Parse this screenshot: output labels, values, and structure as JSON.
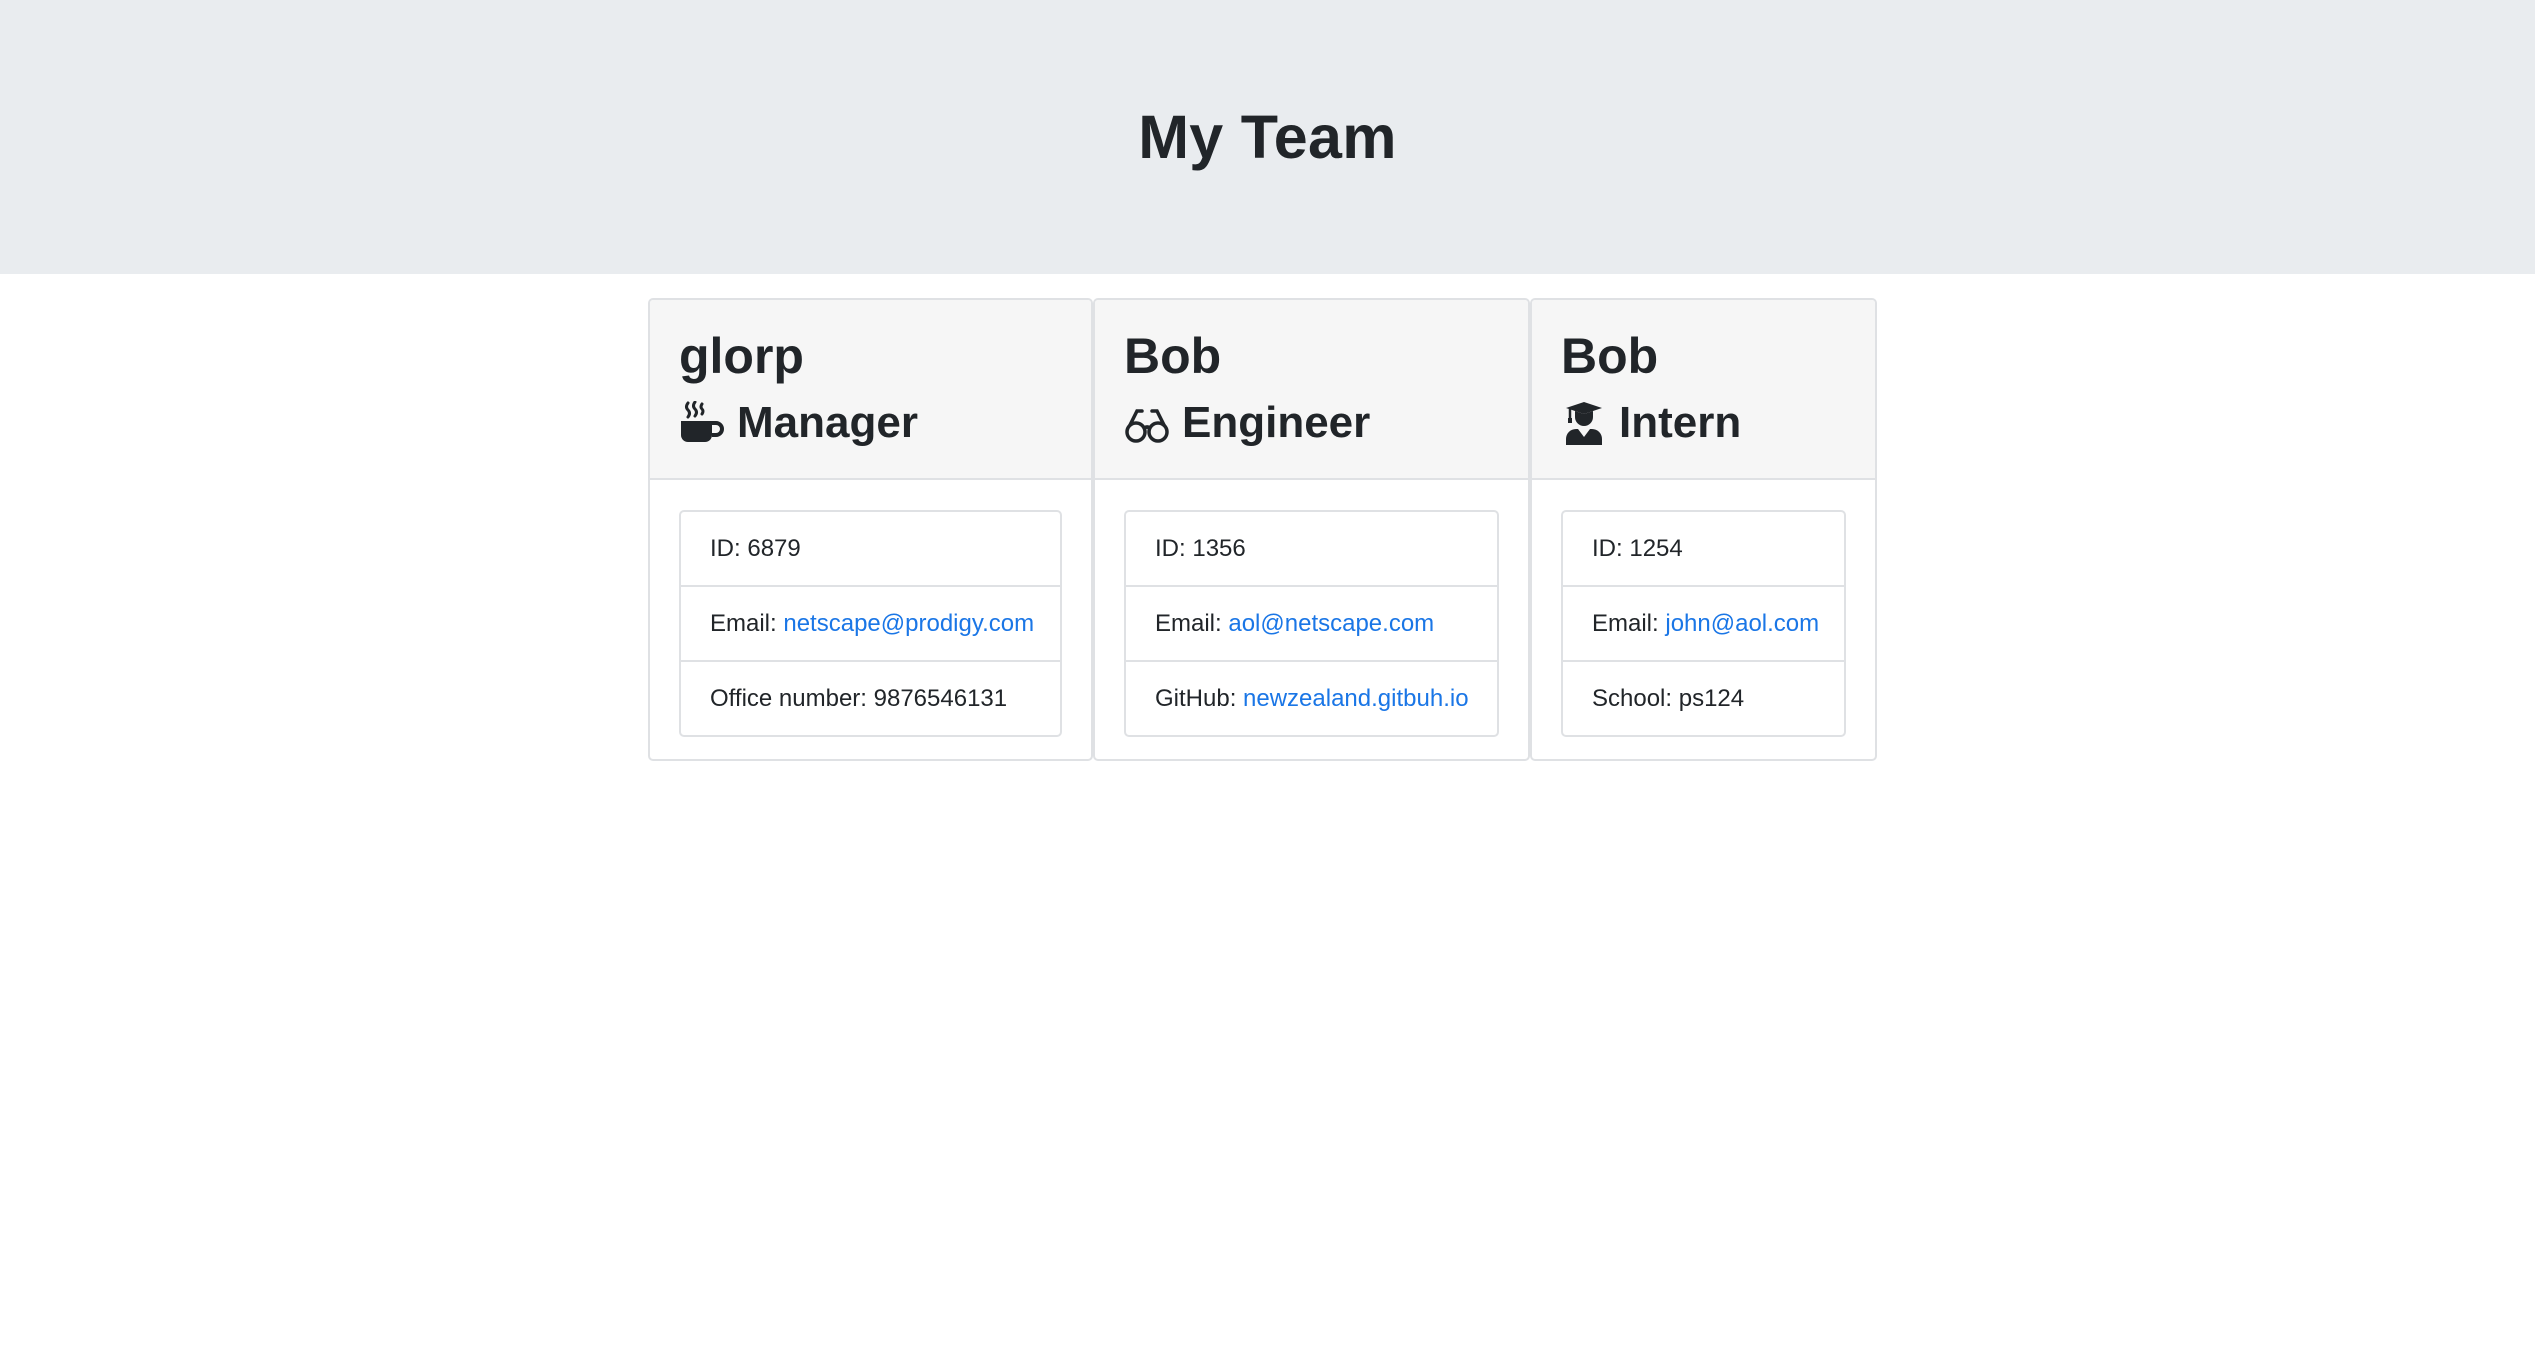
{
  "header": {
    "title": "My Team"
  },
  "employees": [
    {
      "name": "glorp",
      "role": "Manager",
      "icon": "coffee-icon",
      "id_label": "ID: ",
      "id": "6879",
      "email_label": "Email: ",
      "email": "netscape@prodigy.com",
      "extra_label": "Office number: ",
      "extra_value": "9876546131"
    },
    {
      "name": "Bob",
      "role": "Engineer",
      "icon": "glasses-icon",
      "id_label": "ID: ",
      "id": "1356",
      "email_label": "Email: ",
      "email": "aol@netscape.com",
      "extra_label": "GitHub: ",
      "extra_value": "newzealand.gitbuh.io"
    },
    {
      "name": "Bob",
      "role": "Intern",
      "icon": "graduate-icon",
      "id_label": "ID: ",
      "id": "1254",
      "email_label": "Email: ",
      "email": "john@aol.com",
      "extra_label": "School: ",
      "extra_value": "ps124"
    }
  ],
  "colors": {
    "header_bg": "#e9ecef",
    "card_header_bg": "#f6f6f6",
    "link": "#1a76e6",
    "border": "#dfe1e4",
    "text": "#212529"
  }
}
